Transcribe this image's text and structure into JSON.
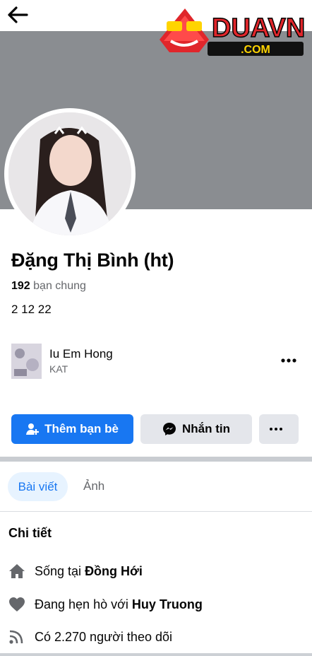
{
  "header": {
    "back_icon": "arrow-left-icon"
  },
  "watermark": {
    "brand": "DUAVN",
    "domain": ".COM"
  },
  "profile": {
    "name": "Đặng Thị Bình (ht)",
    "mutual_count": "192",
    "mutual_label": "bạn chung",
    "bio": "2 12 22"
  },
  "song": {
    "title": "Iu Em Hong",
    "artist": "KAT"
  },
  "actions": {
    "add_friend": "Thêm bạn bè",
    "message": "Nhắn tin"
  },
  "tabs": {
    "posts": "Bài viết",
    "photos": "Ảnh"
  },
  "details": {
    "heading": "Chi tiết",
    "lives_prefix": "Sống tại",
    "lives_place": "Đồng Hới",
    "dating_prefix": "Đang hẹn hò với",
    "dating_name": "Huy Truong",
    "followers": "Có 2.270 người theo dõi"
  },
  "colors": {
    "accent": "#1877f2",
    "cover": "#8a8d91",
    "secondary_text": "#65676b"
  }
}
